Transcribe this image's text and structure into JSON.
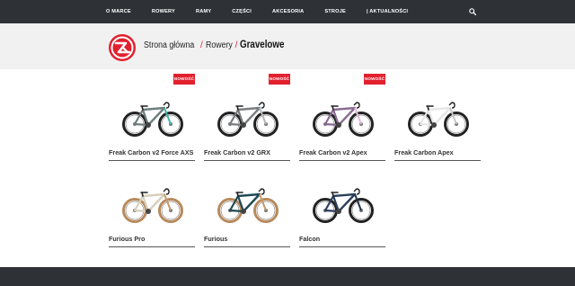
{
  "nav": {
    "items": [
      "O MARCE",
      "ROWERY",
      "RAMY",
      "CZĘŚCI",
      "AKCESORIA",
      "STROJE",
      "| AKTUALNOŚCI"
    ],
    "search_icon": "search-icon"
  },
  "breadcrumb": {
    "home": "Strona główna",
    "section": "Rowery",
    "separator": "/",
    "current": "Gravelowe"
  },
  "products": [
    {
      "name": "Freak Carbon v2 Force AXS",
      "badge": "NOWOŚĆ",
      "frame_color": "#6f7d7d",
      "accent_color": "#3fb7a8"
    },
    {
      "name": "Freak Carbon v2 GRX",
      "badge": "NOWOŚĆ",
      "frame_color": "#7a7d80",
      "accent_color": "#b5b8bb"
    },
    {
      "name": "Freak Carbon v2 Apex",
      "badge": "NOWOŚĆ",
      "frame_color": "#8a6a92",
      "accent_color": "#e6b9d8"
    },
    {
      "name": "Freak Carbon Apex",
      "badge": "",
      "frame_color": "#e7e7e7",
      "accent_color": "#c8c8c8"
    },
    {
      "name": "Furious Pro",
      "badge": "",
      "frame_color": "#d8cfbc",
      "accent_color": "#c29a6e"
    },
    {
      "name": "Furious",
      "badge": "",
      "frame_color": "#1f4a55",
      "accent_color": "#c29a6e"
    },
    {
      "name": "Falcon",
      "badge": "",
      "frame_color": "#2b3f5c",
      "accent_color": "#22324a"
    }
  ],
  "colors": {
    "nav_bg": "#2e3237",
    "hero_bg": "#f1f1f1",
    "brand_red": "#e2202e"
  }
}
